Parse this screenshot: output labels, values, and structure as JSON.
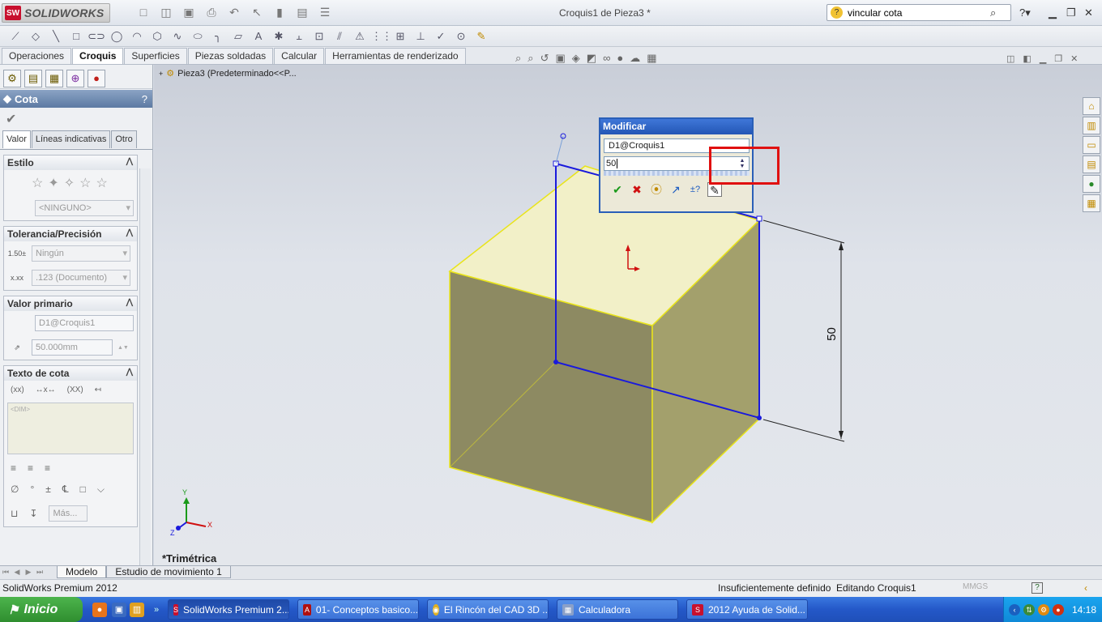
{
  "app": {
    "logo_text": "SOLIDWORKS",
    "document_title": "Croquis1 de Pieza3 *",
    "search_value": "vincular cota"
  },
  "command_tabs": [
    "Operaciones",
    "Croquis",
    "Superficies",
    "Piezas soldadas",
    "Calcular",
    "Herramientas de renderizado"
  ],
  "property_manager": {
    "title": "Cota",
    "help": "?",
    "subtabs": [
      "Valor",
      "Líneas indicativas",
      "Otro"
    ],
    "estilo": {
      "title": "Estilo",
      "select_value": "<NINGUNO>"
    },
    "tolerancia": {
      "title": "Tolerancia/Precisión",
      "tolerance_value": "Ningún",
      "precision_value": ".123 (Documento)"
    },
    "valor_primario": {
      "title": "Valor primario",
      "name_value": "D1@Croquis1",
      "value": "50.000mm"
    },
    "texto_cota": {
      "title": "Texto de cota",
      "textarea_value": "<DIM>",
      "more_button": "Más..."
    }
  },
  "graphics": {
    "tree_label": "Pieza3  (Predeterminado<<P...",
    "view_label": "*Trimétrica",
    "dimension_label": "50",
    "triad": {
      "x": "X",
      "y": "Y",
      "z": "Z"
    }
  },
  "modify_dialog": {
    "title": "Modificar",
    "name_field": "D1@Croquis1",
    "value_field": "50"
  },
  "model_tabs": [
    "Modelo",
    "Estudio de movimiento 1"
  ],
  "status": {
    "product": "SolidWorks Premium 2012",
    "definition": "Insuficientemente definido",
    "editing": "Editando Croquis1",
    "units": "MMGS"
  },
  "taskbar": {
    "start_label": "Inicio",
    "buttons": [
      "SolidWorks Premium 2...",
      "01- Conceptos basico...",
      "El Rincón del CAD 3D ...",
      "Calculadora",
      "2012 Ayuda de Solid..."
    ],
    "clock": "14:18"
  },
  "colors": {
    "sketch_line": "#1a1adc",
    "highlight": "#e01010",
    "cube_edge": "#e9e41a",
    "dialog_title": "#2356b5"
  }
}
